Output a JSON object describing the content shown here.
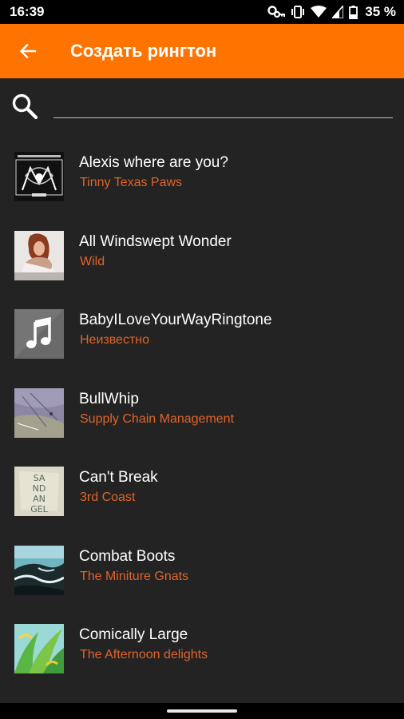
{
  "status_bar": {
    "time": "16:39",
    "battery": "35 %",
    "icons": [
      "key-icon",
      "vibrate-icon",
      "wifi-icon",
      "signal-icon",
      "battery-icon"
    ]
  },
  "app_bar": {
    "title": "Создать рингтон",
    "background": "#ff7400",
    "back_icon": "arrow-back-icon"
  },
  "search": {
    "placeholder": "",
    "value": "",
    "icon": "search-icon"
  },
  "songs": [
    {
      "title": "Alexis where are you?",
      "artist": "Tinny Texas Paws"
    },
    {
      "title": "All Windswept Wonder",
      "artist": "Wild"
    },
    {
      "title": "BabyILoveYourWayRingtone",
      "artist": "Неизвестно"
    },
    {
      "title": "BullWhip",
      "artist": "Supply Chain Management"
    },
    {
      "title": "Can't Break",
      "artist": "3rd Coast"
    },
    {
      "title": "Combat Boots",
      "artist": "The Miniture Gnats"
    },
    {
      "title": "Comically Large",
      "artist": "The Afternoon delights"
    }
  ],
  "thumb_texts": {
    "can_t_break_letters": [
      "SA",
      "ND",
      "AN",
      "GEL"
    ]
  },
  "colors": {
    "accent": "#ff7400",
    "artist_text": "#e0642a",
    "background": "#232323"
  }
}
